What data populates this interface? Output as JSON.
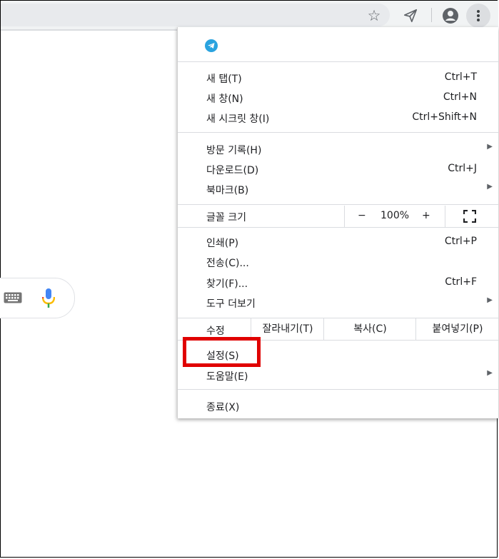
{
  "toolbar": {
    "star_icon": "star-icon",
    "extension_icon": "send-icon",
    "account_icon": "account-circle-icon",
    "menu_icon": "more-vert-icon"
  },
  "search": {
    "keyboard_icon": "keyboard-icon",
    "mic_icon": "microphone-icon"
  },
  "menu": {
    "extension_icon": "telegram-icon",
    "new_tab": {
      "label": "새 탭(T)",
      "shortcut": "Ctrl+T"
    },
    "new_window": {
      "label": "새 창(N)",
      "shortcut": "Ctrl+N"
    },
    "incognito": {
      "label": "새 시크릿 창(I)",
      "shortcut": "Ctrl+Shift+N"
    },
    "history": {
      "label": "방문 기록(H)"
    },
    "downloads": {
      "label": "다운로드(D)",
      "shortcut": "Ctrl+J"
    },
    "bookmarks": {
      "label": "북마크(B)"
    },
    "zoom": {
      "label": "글꼴 크기",
      "minus": "−",
      "value": "100%",
      "plus": "+"
    },
    "print": {
      "label": "인쇄(P)",
      "shortcut": "Ctrl+P"
    },
    "cast": {
      "label": "전송(C)..."
    },
    "find": {
      "label": "찾기(F)...",
      "shortcut": "Ctrl+F"
    },
    "more_tools": {
      "label": "도구 더보기"
    },
    "edit": {
      "label": "수정",
      "cut": "잘라내기(T)",
      "copy": "복사(C)",
      "paste": "붙여넣기(P)"
    },
    "settings": {
      "label": "설정(S)"
    },
    "help": {
      "label": "도움말(E)"
    },
    "exit": {
      "label": "종료(X)"
    }
  },
  "colors": {
    "highlight": "#e00000",
    "telegram": "#2aa3df"
  }
}
